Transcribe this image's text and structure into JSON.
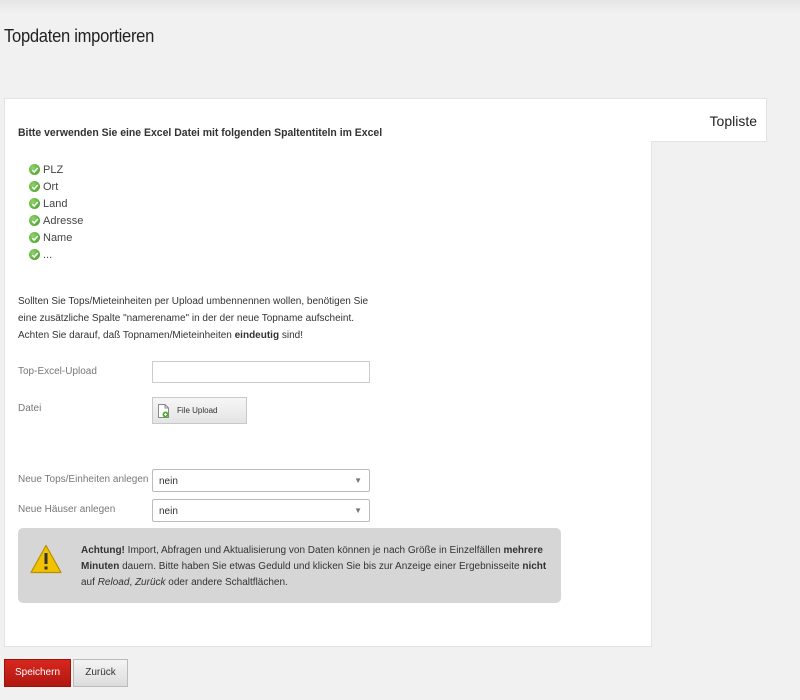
{
  "page": {
    "title": "Topdaten importieren"
  },
  "tabs": {
    "topliste": "Topliste"
  },
  "intro": "Bitte verwenden Sie eine Excel Datei mit folgenden Spaltentiteln im Excel",
  "columns": [
    "PLZ",
    "Ort",
    "Land",
    "Adresse",
    "Name",
    "..."
  ],
  "rename_note": {
    "part1": "Sollten Sie Tops/Mieteinheiten per Upload umbennennen wollen, benötigen Sie eine zusätzliche Spalte \"namerename\" in der der neue Topname aufscheint. Achten Sie darauf, daß Topnamen/Mieteinheiten ",
    "bold": "eindeutig",
    "part2": " sind!"
  },
  "form": {
    "top_excel_upload_label": "Top-Excel-Upload",
    "top_excel_upload_value": "",
    "datei_label": "Datei",
    "file_upload_button": "File Upload",
    "neue_tops_label": "Neue Tops/Einheiten anlegen",
    "neue_tops_value": "nein",
    "neue_haeuser_label": "Neue Häuser anlegen",
    "neue_haeuser_value": "nein"
  },
  "warning": {
    "title": "Achtung!",
    "t1": " Import, Abfragen und Aktualisierung von Daten können je nach Größe in Einzelfällen ",
    "b1": "mehrere Minuten",
    "t2": " dauern. Bitte haben Sie etwas Geduld und klicken Sie bis zur Anzeige einer Ergebnisseite ",
    "b2": "nicht",
    "t3": " auf ",
    "i1": "Reload",
    "t4": ", ",
    "i2": "Zurück",
    "t5": " oder andere Schaltflächen."
  },
  "buttons": {
    "save": "Speichern",
    "back": "Zurück"
  },
  "colors": {
    "accent_red": "#c4201a",
    "check_green": "#4caf2a",
    "warning_yellow": "#f2c200"
  }
}
